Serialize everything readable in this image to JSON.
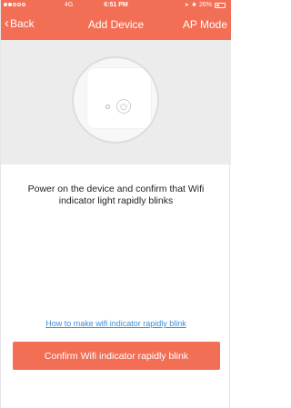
{
  "status_bar": {
    "network": "4G",
    "time": "6:51 PM",
    "battery": "26%"
  },
  "nav": {
    "back_label": "Back",
    "title": "Add Device",
    "right_label": "AP Mode"
  },
  "illustration": {
    "icons": [
      "device-icon",
      "power-icon",
      "indicator-light-icon"
    ]
  },
  "instruction": "Power on the device and confirm that Wifi indicator light rapidly blinks",
  "help_link": "How to make wifi indicator rapidly blink",
  "confirm_button": "Confirm Wifi indicator rapidly blink",
  "colors": {
    "accent": "#f26f55",
    "link": "#3b8ed8",
    "hero_bg": "#ececec"
  }
}
